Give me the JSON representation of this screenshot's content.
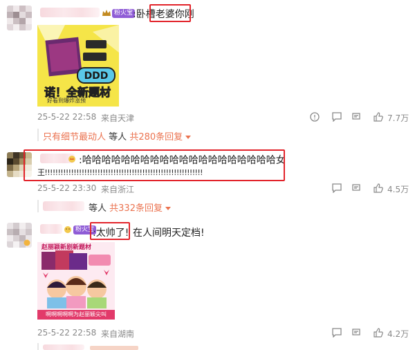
{
  "comments": [
    {
      "text": ":卧槽老婆你刚",
      "badge": "粉火宝",
      "image_caption": "诺！全新题材",
      "image_sub": "好看到爆炸涨预",
      "date": "25-5-22 22:58",
      "location": "来自天津",
      "likes": "7.7万",
      "reply_prefix": "只有细节最动人",
      "reply_mid": "等人",
      "reply_total": "共280条回复"
    },
    {
      "text_line1": ":哈哈哈哈哈哈哈哈哈哈哈哈哈哈哈哈哈哈哈哈女",
      "text_line2": "王!!!!!!!!!!!!!!!!!!!!!!!!!!!!!!!!!!!!!!!!!!!!!!!!!!!!!!!!!!!!",
      "date": "25-5-22 23:30",
      "location": "来自浙江",
      "likes": "4.5万",
      "reply_mid": "等人",
      "reply_total": "共332条回复"
    },
    {
      "highlight": ":太帅了!",
      "text_rest": "在人间明天定档!",
      "badge": "粉火宝",
      "image_title": "赵丽颖新剧新题材",
      "image_caption": "啊啊啊啊啊为赵丽颖尖叫",
      "date": "25-5-22 22:58",
      "location": "来自湖南",
      "likes": "4.2万"
    }
  ],
  "colors": {
    "highlight_box": "#e2232a",
    "reply_link": "#eb7350",
    "meta_text": "#888888"
  },
  "icons": [
    "share-icon",
    "comment-icon",
    "like-icon"
  ]
}
